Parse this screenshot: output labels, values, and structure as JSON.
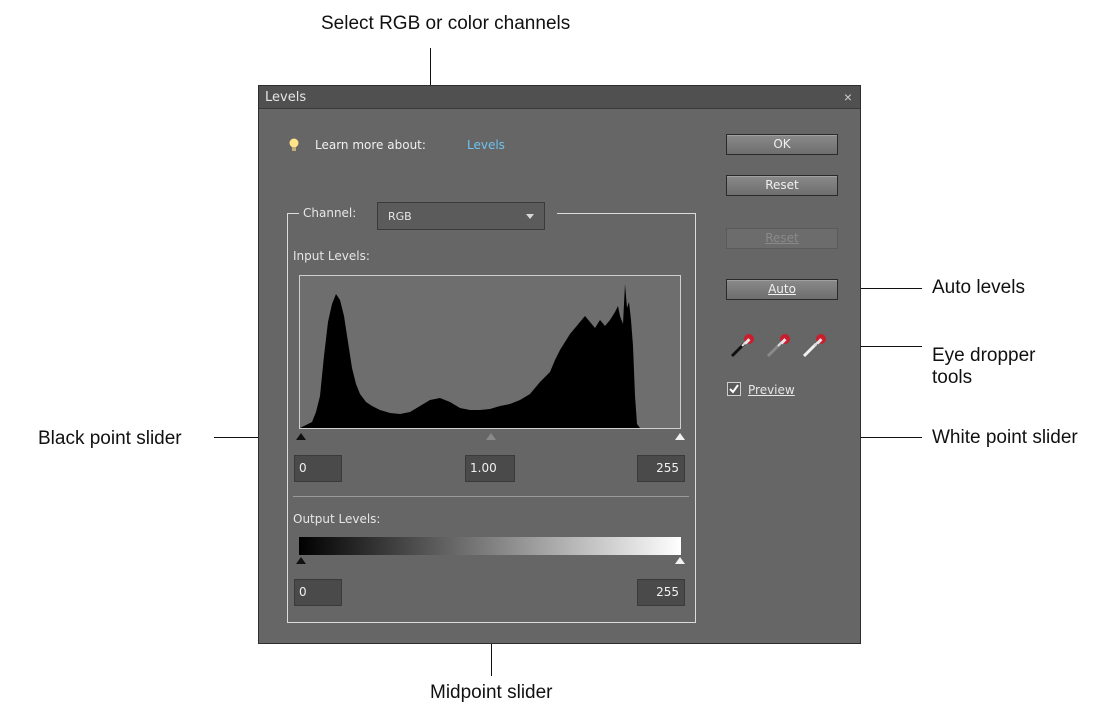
{
  "callouts": {
    "select_channels": "Select RGB or color channels",
    "auto_levels": "Auto levels",
    "eye_dropper": "Eye dropper\ntools",
    "black_point": "Black point slider",
    "white_point": "White point slider",
    "midpoint": "Midpoint slider"
  },
  "dialog": {
    "title": "Levels",
    "close_glyph": "×",
    "learn_more_prefix": "Learn more about:",
    "learn_more_link": "Levels",
    "channel_label": "Channel:",
    "channel_value": "RGB",
    "input_levels_label": "Input Levels:",
    "output_levels_label": "Output Levels:",
    "input_black": "0",
    "input_mid": "1.00",
    "input_white": "255",
    "output_black": "0",
    "output_white": "255",
    "buttons": {
      "ok": "OK",
      "reset": "Reset",
      "reset_disabled": "Reset",
      "auto": "Auto"
    },
    "preview_label": "Preview",
    "preview_checked": true,
    "colors": {
      "dialog_bg": "#666666",
      "link": "#6fc3f0",
      "histogram_bg": "#6e6e6e",
      "dropper_red": "#c81e2e"
    }
  }
}
